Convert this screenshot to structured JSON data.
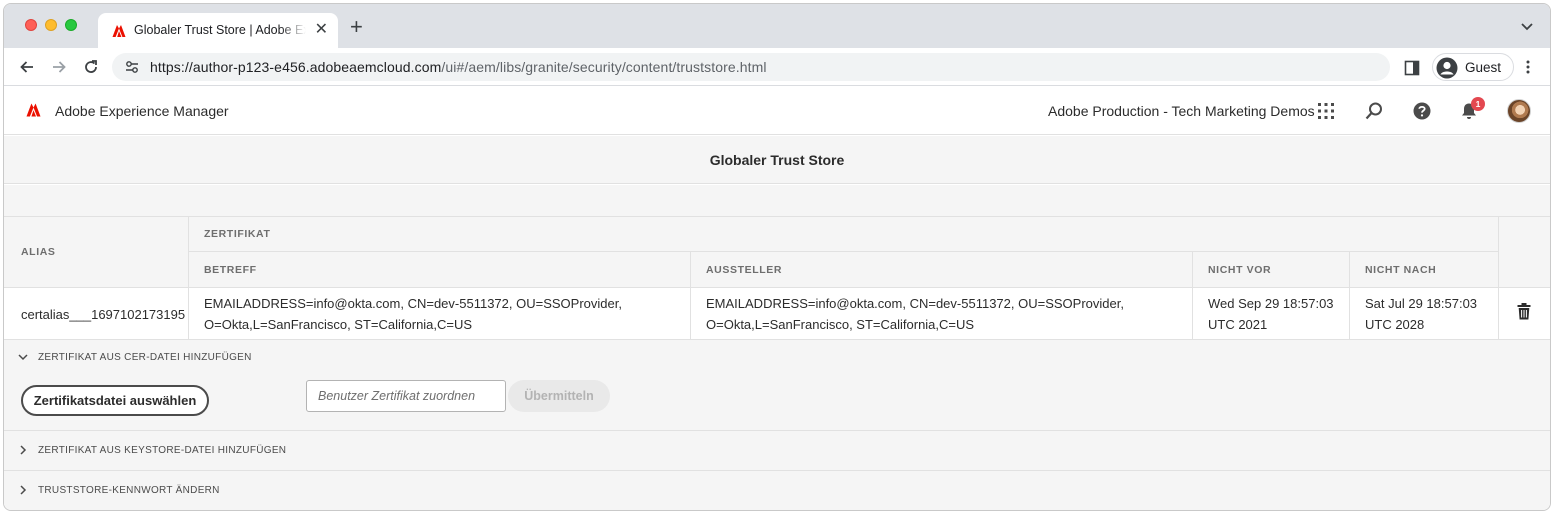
{
  "browser": {
    "tab_title": "Globaler Trust Store | Adobe Experience Manager",
    "url_host": "https://author-p123-e456.adobeaemcloud.com",
    "url_path": "/ui#/aem/libs/granite/security/content/truststore.html",
    "profile_label": "Guest"
  },
  "aem": {
    "product_name": "Adobe Experience Manager",
    "org_name": "Adobe Production - Tech Marketing Demos",
    "notification_count": "1",
    "brand_color": "#eb1000"
  },
  "page": {
    "title": "Globaler Trust Store"
  },
  "table": {
    "headers": {
      "alias": "ALIAS",
      "certificate": "ZERTIFIKAT",
      "subject": "BETREFF",
      "issuer": "AUSSTELLER",
      "not_before": "NICHT VOR",
      "not_after": "NICHT NACH"
    },
    "rows": [
      {
        "alias": "certalias___1697102173195",
        "subject_line1": "EMAILADDRESS=info@okta.com, CN=dev-5511372, OU=SSOProvider,",
        "subject_line2": "O=Okta,L=SanFrancisco, ST=California,C=US",
        "issuer_line1": "EMAILADDRESS=info@okta.com, CN=dev-5511372, OU=SSOProvider,",
        "issuer_line2": "O=Okta,L=SanFrancisco, ST=California,C=US",
        "not_before_line1": "Wed Sep 29 18:57:03",
        "not_before_line2": "UTC 2021",
        "not_after_line1": "Sat Jul 29 18:57:03",
        "not_after_line2": "UTC 2028"
      }
    ]
  },
  "sections": {
    "cer": {
      "label": "ZERTIFIKAT AUS CER-DATEI HINZUFÜGEN",
      "select_button": "Zertifikatsdatei auswählen",
      "input_placeholder": "Benutzer Zertifikat zuordnen",
      "submit_button": "Übermitteln"
    },
    "keystore": {
      "label": "ZERTIFIKAT AUS KEYSTORE-DATEI HINZUFÜGEN"
    },
    "password": {
      "label": "TRUSTSTORE-KENNWORT ÄNDERN"
    }
  }
}
